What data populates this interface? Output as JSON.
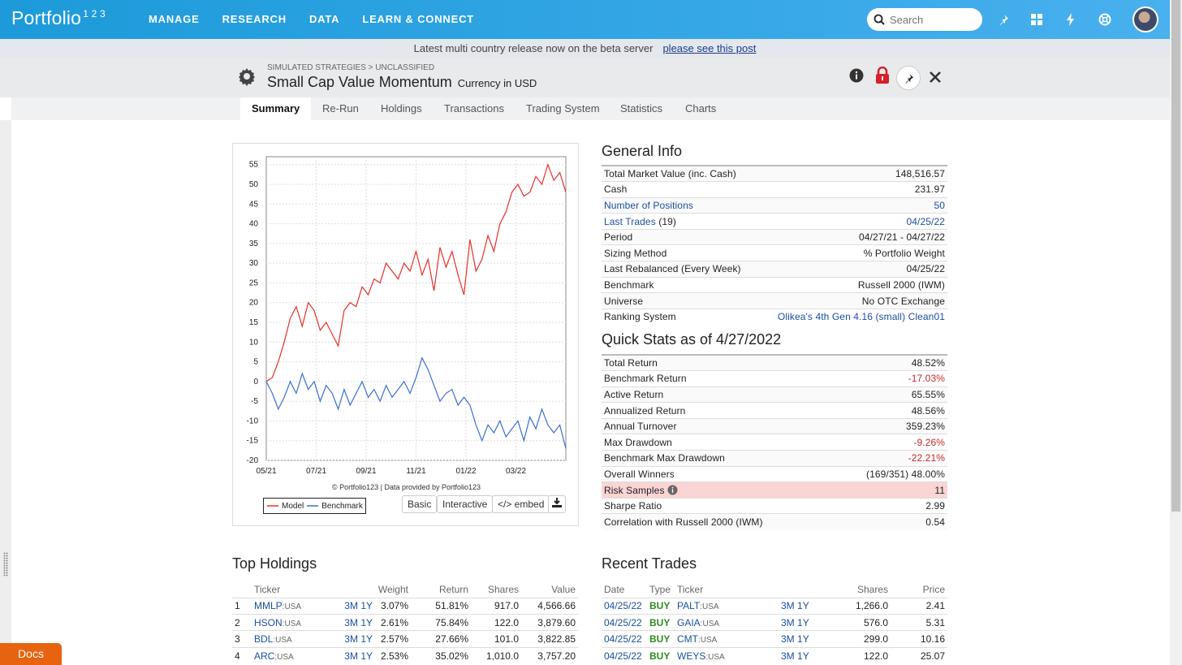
{
  "nav": {
    "logo_text": "Portfolio",
    "logo_sup": "1 2 3",
    "links": [
      "MANAGE",
      "RESEARCH",
      "DATA",
      "LEARN & CONNECT"
    ],
    "search_placeholder": "Search"
  },
  "banner": {
    "text": "Latest multi country release now on the beta server",
    "link": "please see this post"
  },
  "header": {
    "breadcrumb": "SIMULATED STRATEGIES > UNCLASSIFIED",
    "title": "Small Cap Value Momentum",
    "currency": "Currency in USD"
  },
  "tabs": [
    "Summary",
    "Re-Run",
    "Holdings",
    "Transactions",
    "Trading System",
    "Statistics",
    "Charts"
  ],
  "chart": {
    "copyright": "© Portfolio123 | Data provided by Portfolio123",
    "buttons": {
      "basic": "Basic",
      "interactive": "Interactive",
      "embed": "</> embed"
    }
  },
  "chart_data": {
    "type": "line",
    "xticks": [
      "05/21",
      "07/21",
      "09/21",
      "11/21",
      "01/22",
      "03/22"
    ],
    "yticks": [
      55,
      50,
      45,
      40,
      35,
      30,
      25,
      20,
      15,
      10,
      5,
      0,
      -5,
      -10,
      -15,
      -20
    ],
    "ylim": [
      -20,
      57
    ],
    "grid": true,
    "legend_position": "bottom-left",
    "colors": {
      "Model": "#e8302a",
      "Benchmark": "#3a6fd1"
    },
    "series": [
      {
        "name": "Model",
        "x": [
          0,
          2,
          4,
          6,
          8,
          10,
          12,
          14,
          16,
          18,
          20,
          22,
          24,
          26,
          28,
          30,
          32,
          34,
          36,
          38,
          40,
          42,
          44,
          46,
          48,
          50,
          52,
          54,
          56,
          58,
          60,
          62,
          64,
          66,
          68,
          70,
          72,
          74,
          76,
          78,
          80,
          82,
          84,
          86,
          88,
          90,
          92,
          94,
          96,
          98,
          100
        ],
        "values": [
          0,
          1,
          5,
          10,
          16,
          19,
          14,
          20,
          18,
          13,
          15,
          12,
          9,
          18,
          20,
          19,
          24,
          22,
          26,
          25,
          30,
          28,
          26,
          30,
          28,
          33,
          27,
          31,
          23,
          34,
          29,
          33,
          27,
          22,
          36,
          28,
          31,
          37,
          33,
          40,
          43,
          48,
          50,
          47,
          48,
          52,
          50,
          55,
          51,
          53,
          48
        ]
      },
      {
        "name": "Benchmark",
        "x": [
          0,
          2,
          4,
          6,
          8,
          10,
          12,
          14,
          16,
          18,
          20,
          22,
          24,
          26,
          28,
          30,
          32,
          34,
          36,
          38,
          40,
          42,
          44,
          46,
          48,
          50,
          52,
          54,
          56,
          58,
          60,
          62,
          64,
          66,
          68,
          70,
          72,
          74,
          76,
          78,
          80,
          82,
          84,
          86,
          88,
          90,
          92,
          94,
          96,
          98,
          100
        ],
        "values": [
          0,
          -3,
          -7,
          -4,
          0,
          -3,
          2,
          -2,
          0,
          -5,
          -1,
          -3,
          -7,
          -2,
          -6,
          -3,
          0,
          -4,
          -2,
          -5,
          -1,
          -4,
          -2,
          0,
          -3,
          1,
          6,
          3,
          -1,
          -5,
          -3,
          -2,
          -6,
          -4,
          -6,
          -11,
          -15,
          -11,
          -13,
          -10,
          -14,
          -12,
          -10,
          -15,
          -9,
          -12,
          -7,
          -11,
          -13,
          -11,
          -17
        ]
      }
    ]
  },
  "general_info": {
    "title": "General Info",
    "rows": [
      {
        "label": "Total Market Value (inc. Cash)",
        "value": "148,516.57"
      },
      {
        "label": "Cash",
        "value": "231.97"
      },
      {
        "label": "Number of Positions",
        "value": "50"
      },
      {
        "label": "Last Trades",
        "extra": " (19)",
        "value": "04/25/22"
      },
      {
        "label": "Period",
        "value": "04/27/21 - 04/27/22"
      },
      {
        "label": "Sizing Method",
        "value": "% Portfolio Weight"
      },
      {
        "label": "Last Rebalanced (Every Week)",
        "value": "04/25/22"
      },
      {
        "label": "Benchmark",
        "value": "Russell 2000 (IWM)"
      },
      {
        "label": "Universe",
        "value": "No OTC Exchange"
      },
      {
        "label": "Ranking System",
        "value": "Olikea's 4th Gen 4.16 (small) Clean01"
      }
    ]
  },
  "quick_stats": {
    "title": "Quick Stats as of 4/27/2022",
    "rows": [
      {
        "label": "Total Return",
        "value": "48.52%"
      },
      {
        "label": "Benchmark Return",
        "value": "-17.03%"
      },
      {
        "label": "Active Return",
        "value": "65.55%"
      },
      {
        "label": "Annualized Return",
        "value": "48.56%"
      },
      {
        "label": "Annual Turnover",
        "value": "359.23%"
      },
      {
        "label": "Max Drawdown",
        "value": "-9.26%"
      },
      {
        "label": "Benchmark Max Drawdown",
        "value": "-22.21%"
      },
      {
        "label": "Overall Winners",
        "value": "(169/351) 48.00%"
      },
      {
        "label": "Risk Samples",
        "value": "11"
      },
      {
        "label": "Sharpe Ratio",
        "value": "2.99"
      },
      {
        "label": "Correlation with Russell 2000 (IWM)",
        "value": "0.54"
      }
    ]
  },
  "top_holdings": {
    "title": "Top Holdings",
    "headers": [
      "Ticker",
      "Weight",
      "Return",
      "Shares",
      "Value"
    ],
    "rows": [
      {
        "n": "1",
        "ticker": "MMLP",
        "mkt": ":USA",
        "p1": "3M",
        "p2": "1Y",
        "weight": "3.07%",
        "ret": "51.81%",
        "shares": "917.0",
        "value": "4,566.66"
      },
      {
        "n": "2",
        "ticker": "HSON",
        "mkt": ":USA",
        "p1": "3M",
        "p2": "1Y",
        "weight": "2.61%",
        "ret": "75.84%",
        "shares": "122.0",
        "value": "3,879.60"
      },
      {
        "n": "3",
        "ticker": "BDL",
        "mkt": ":USA",
        "p1": "3M",
        "p2": "1Y",
        "weight": "2.57%",
        "ret": "27.66%",
        "shares": "101.0",
        "value": "3,822.85"
      },
      {
        "n": "4",
        "ticker": "ARC",
        "mkt": ":USA",
        "p1": "3M",
        "p2": "1Y",
        "weight": "2.53%",
        "ret": "35.02%",
        "shares": "1,010.0",
        "value": "3,757.20"
      }
    ]
  },
  "recent_trades": {
    "title": "Recent Trades",
    "headers": [
      "Date",
      "Type",
      "Ticker",
      "Shares",
      "Price"
    ],
    "rows": [
      {
        "date": "04/25/22",
        "type": "BUY",
        "ticker": "PALT",
        "mkt": ":USA",
        "p1": "3M",
        "p2": "1Y",
        "shares": "1,266.0",
        "price": "2.41"
      },
      {
        "date": "04/25/22",
        "type": "BUY",
        "ticker": "GAIA",
        "mkt": ":USA",
        "p1": "3M",
        "p2": "1Y",
        "shares": "576.0",
        "price": "5.31"
      },
      {
        "date": "04/25/22",
        "type": "BUY",
        "ticker": "CMT",
        "mkt": ":USA",
        "p1": "3M",
        "p2": "1Y",
        "shares": "299.0",
        "price": "10.16"
      },
      {
        "date": "04/25/22",
        "type": "BUY",
        "ticker": "WEYS",
        "mkt": ":USA",
        "p1": "3M",
        "p2": "1Y",
        "shares": "122.0",
        "price": "25.07"
      }
    ]
  },
  "docs_label": "Docs"
}
